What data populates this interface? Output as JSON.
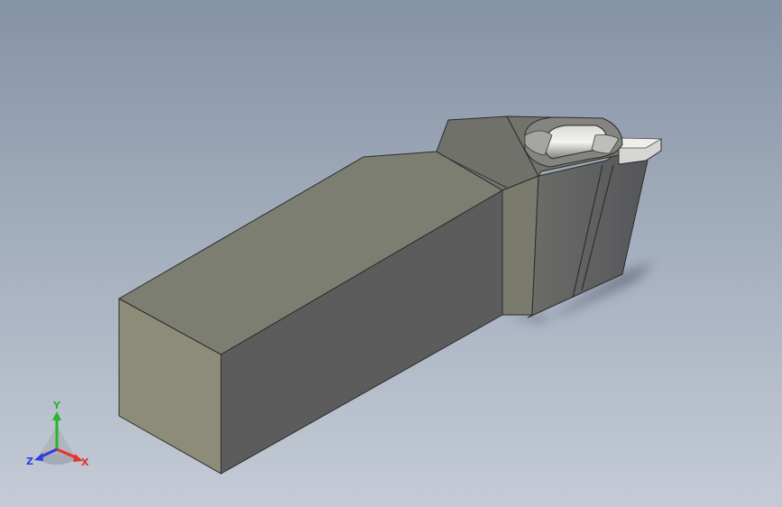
{
  "viewport": {
    "colors": {
      "background_top": "#8593a6",
      "background_bottom": "#c4cbd6"
    }
  },
  "model": {
    "name": "turning-tool-holder",
    "colors": {
      "face_front": "#8c8b78",
      "face_top": "#7c7d72",
      "face_side": "#5b5c5a",
      "head_top": "#6e6f66",
      "head_side": "#636461",
      "insert_light": "#f0f0f0",
      "insert_dark": "#8e8f8c",
      "edge": "#2c2c2a"
    }
  },
  "triad": {
    "axes": [
      {
        "key": "y",
        "label": "Y",
        "color": "#29b52a"
      },
      {
        "key": "x",
        "label": "X",
        "color": "#e8322e"
      },
      {
        "key": "z",
        "label": "Z",
        "color": "#2f3ee0"
      }
    ]
  }
}
